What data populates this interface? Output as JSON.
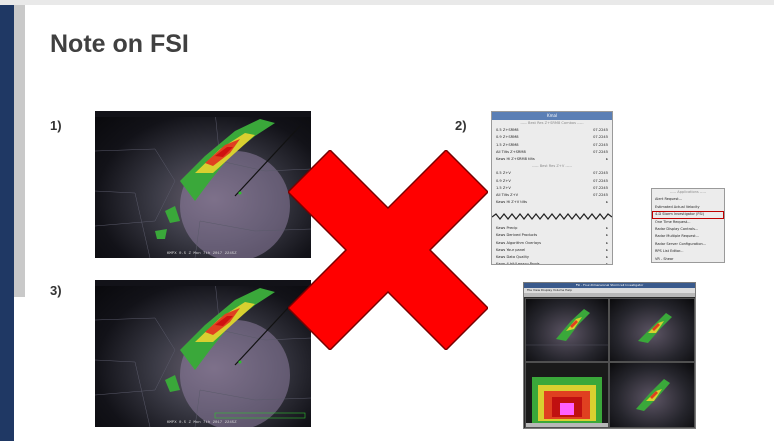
{
  "slide": {
    "title": "Note on FSI",
    "labels": [
      "1)",
      "2)",
      "3)"
    ]
  },
  "colors": {
    "sidebar_navy": "#1f3864",
    "sidebar_gray": "#c9c9c9",
    "title_text": "#404040",
    "x_mark": "#ff0000",
    "highlight_border": "#c00000"
  },
  "menu": {
    "title": "Kmal",
    "rows": [
      {
        "label": "----- Best Res Z+SRM8 Combos -----",
        "value": "",
        "sep": true
      },
      {
        "label": "0.5 Z+SRM8",
        "value": "07.2245"
      },
      {
        "label": "0.9 Z+SRM8",
        "value": "07.2245"
      },
      {
        "label": "1.5 Z+SRM8",
        "value": "07.2245"
      },
      {
        "label": "All Tilts Z+SRM8",
        "value": "07.2245"
      },
      {
        "label": "Kaws Hi Z+SRM8 tilts",
        "value": "▸"
      },
      {
        "label": "----- Best Res Z+V -----",
        "value": "",
        "sep": true
      },
      {
        "label": "0.5 Z+V",
        "value": "07.2245"
      },
      {
        "label": "0.9 Z+V",
        "value": "07.2245"
      },
      {
        "label": "1.5 Z+V",
        "value": "07.2245"
      },
      {
        "label": "All Tilts Z+V",
        "value": "07.2245"
      },
      {
        "label": "Kaws Hi Z+V tilts",
        "value": "▸"
      }
    ],
    "rows_lower": [
      {
        "label": "Kaws Precip",
        "value": "▸"
      },
      {
        "label": "Kaws Derived Products",
        "value": "▸"
      },
      {
        "label": "Kaws Algorithm Overlays",
        "value": "▸"
      },
      {
        "label": "Kaws Your panel",
        "value": "▸"
      },
      {
        "label": "Kaws Data Quality",
        "value": "▸"
      },
      {
        "label": "Kaws 4-bit/Legacy Prods",
        "value": "▸"
      },
      {
        "label": "Radar Applications",
        "value": "▸",
        "selected": true
      }
    ]
  },
  "submenu": {
    "rows": [
      {
        "label": "----- Applications -----",
        "sep": true
      },
      {
        "label": "Alert Request..."
      },
      {
        "label": "Estimated Actual Velocity"
      },
      {
        "label": "4-D Storm Investigator (FSI)",
        "selected": true
      },
      {
        "label": "One Time Request..."
      },
      {
        "label": "Radar Display Controls..."
      },
      {
        "label": "Radar Multiple Request..."
      },
      {
        "label": "Radar Server Configuration..."
      },
      {
        "label": "RPS List Editor..."
      },
      {
        "label": "VR - Shear"
      }
    ]
  },
  "fsi_window": {
    "title": "FSI - Four-Dimensional Stormcell Investigator",
    "menubar": "File   View   Display   Volume   Help"
  },
  "radar1": {
    "stamp": "KMPX 0.5 Z  Mon 7th 2017  2245Z"
  },
  "radar3": {
    "stamp": "KMPX 0.5 Z  Mon 7th 2017  2245Z"
  }
}
